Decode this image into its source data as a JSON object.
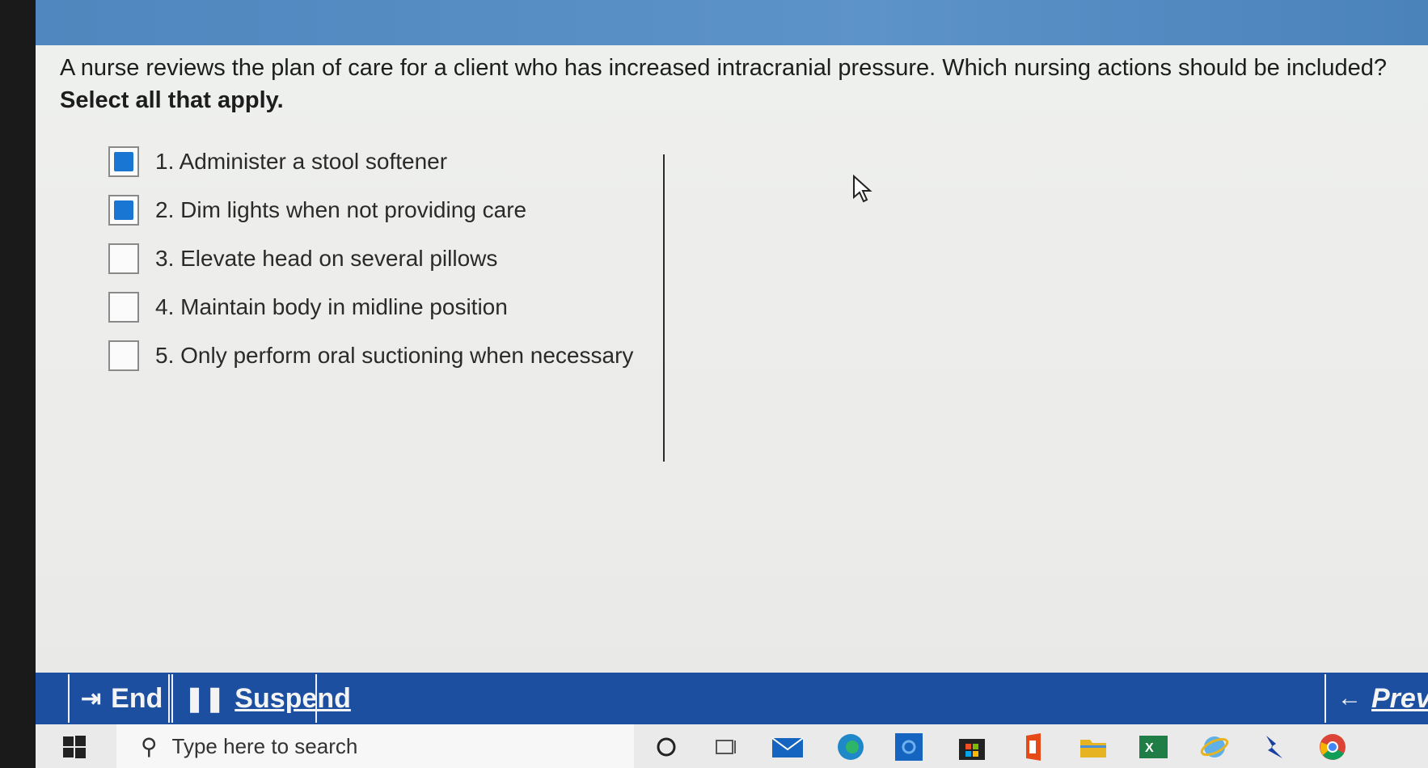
{
  "question": {
    "text": "A nurse reviews the plan of care for a client who has increased intracranial pressure.  Which nursing actions should be included?",
    "instruction": "Select all that apply."
  },
  "options": [
    {
      "label": "1. Administer a stool softener",
      "checked": true
    },
    {
      "label": "2. Dim lights when not providing care",
      "checked": true
    },
    {
      "label": "3. Elevate head on several pillows",
      "checked": false
    },
    {
      "label": "4. Maintain body in midline position",
      "checked": false
    },
    {
      "label": "5. Only perform oral suctioning when necessary",
      "checked": false
    }
  ],
  "actions": {
    "end_label": "End",
    "suspend_label": "Suspend",
    "previous_label": "Previ"
  },
  "taskbar": {
    "search_placeholder": "Type here to search",
    "icons": [
      "windows-start-icon",
      "search-icon",
      "cortana-icon",
      "task-view-icon",
      "mail-icon",
      "edge-icon",
      "outlook-icon",
      "store-icon",
      "office-icon",
      "file-explorer-icon",
      "excel-icon",
      "internet-explorer-icon",
      "app-icon",
      "chrome-icon"
    ]
  },
  "colors": {
    "accent": "#1d4fa0",
    "checkbox_fill": "#1976d2",
    "topbar": "#5c93c8"
  }
}
